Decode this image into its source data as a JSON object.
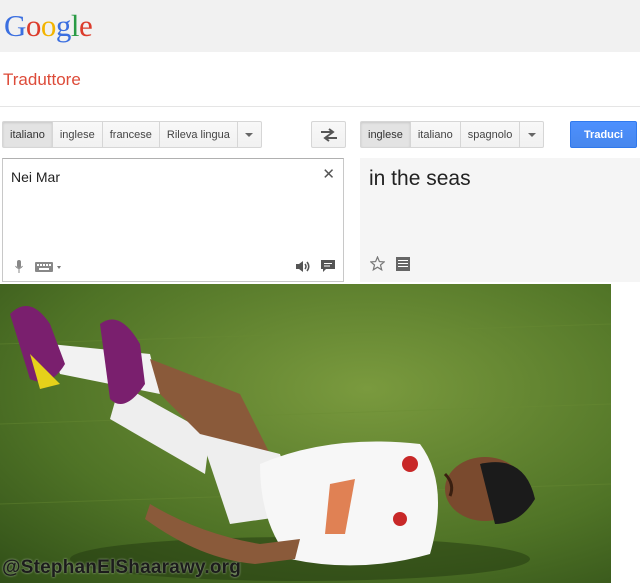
{
  "header": {
    "logo_text": "Google",
    "logo_letters": [
      {
        "ch": "G",
        "color": "#3b6fe0"
      },
      {
        "ch": "o",
        "color": "#dc3c2c"
      },
      {
        "ch": "o",
        "color": "#f3b400"
      },
      {
        "ch": "g",
        "color": "#3b6fe0"
      },
      {
        "ch": "l",
        "color": "#2a9b45"
      },
      {
        "ch": "e",
        "color": "#dc3c2c"
      }
    ],
    "subtitle": "Traduttore"
  },
  "source": {
    "languages": [
      "italiano",
      "inglese",
      "francese",
      "Rileva lingua"
    ],
    "selected": "italiano",
    "text": "Nei Mar"
  },
  "target": {
    "languages": [
      "inglese",
      "italiano",
      "spagnolo"
    ],
    "selected": "inglese",
    "text": "in the seas"
  },
  "buttons": {
    "translate": "Traduci"
  },
  "icons": {
    "swap": "swap-arrows-icon",
    "clear": "close-icon",
    "mic": "microphone-icon",
    "keyboard": "keyboard-icon",
    "speaker": "speaker-icon",
    "feedback": "speech-bubble-icon",
    "star": "star-icon",
    "list": "list-icon"
  },
  "colors": {
    "translate_button": "#4d90fe",
    "subtitle": "#dd4b39"
  },
  "photo": {
    "watermark": "@StephanElShaarawy.org"
  }
}
